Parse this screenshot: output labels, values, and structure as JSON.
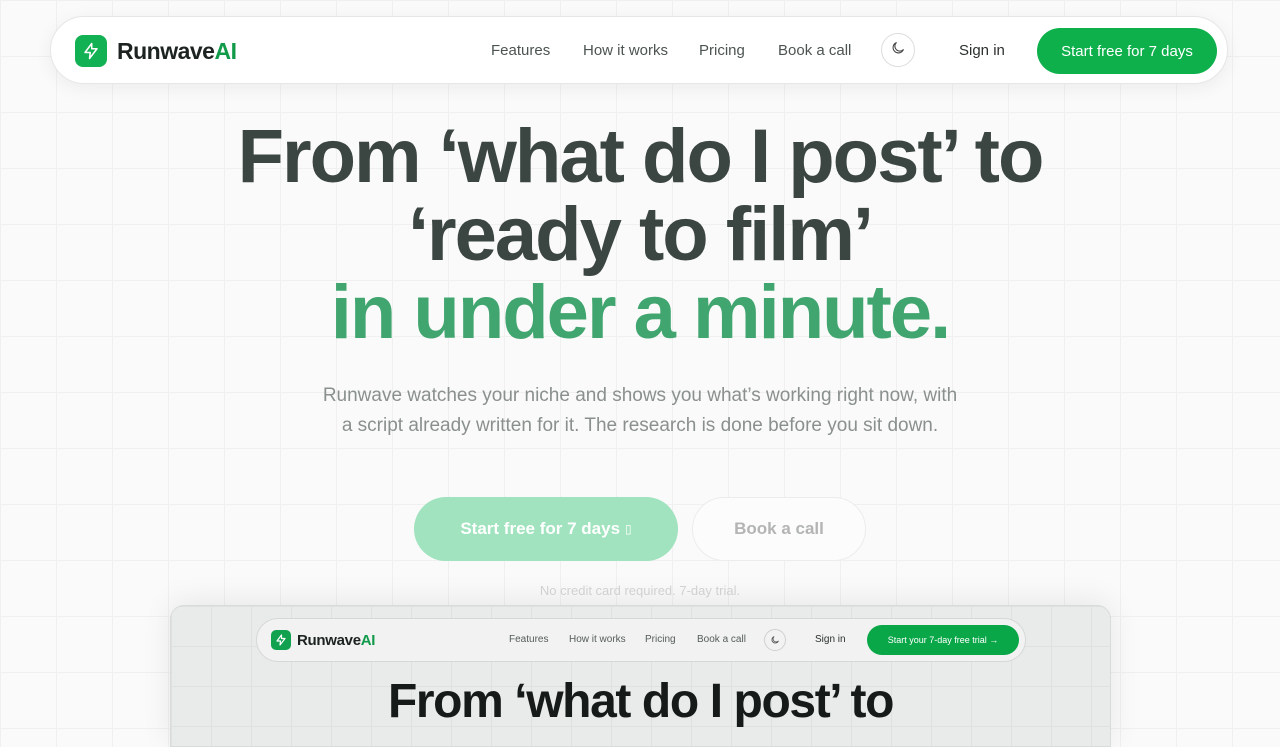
{
  "brand": {
    "name": "Runwave",
    "suffix": "AI",
    "accent": "#0db04b"
  },
  "nav": {
    "links": [
      "Features",
      "How it works",
      "Pricing",
      "Book a call"
    ],
    "signin": "Sign in",
    "cta": "Start free for 7 days"
  },
  "hero": {
    "title_line1": "From ‘what do I post’ to",
    "title_line2": "‘ready to film’",
    "title_line3": "in under a minute.",
    "subtitle": "Runwave watches your niche and shows you what’s working right now, with a script already written for it. The research is done before you sit down.",
    "primary_button": "Start free for 7 days",
    "primary_button_icon": "▯",
    "secondary_button": "Book a call",
    "note": "No credit card required. 7-day trial."
  },
  "preview": {
    "links": [
      "Features",
      "How it works",
      "Pricing",
      "Book a call"
    ],
    "signin": "Sign in",
    "cta": "Start your 7-day free trial →",
    "title": "From ‘what do I post’ to"
  }
}
